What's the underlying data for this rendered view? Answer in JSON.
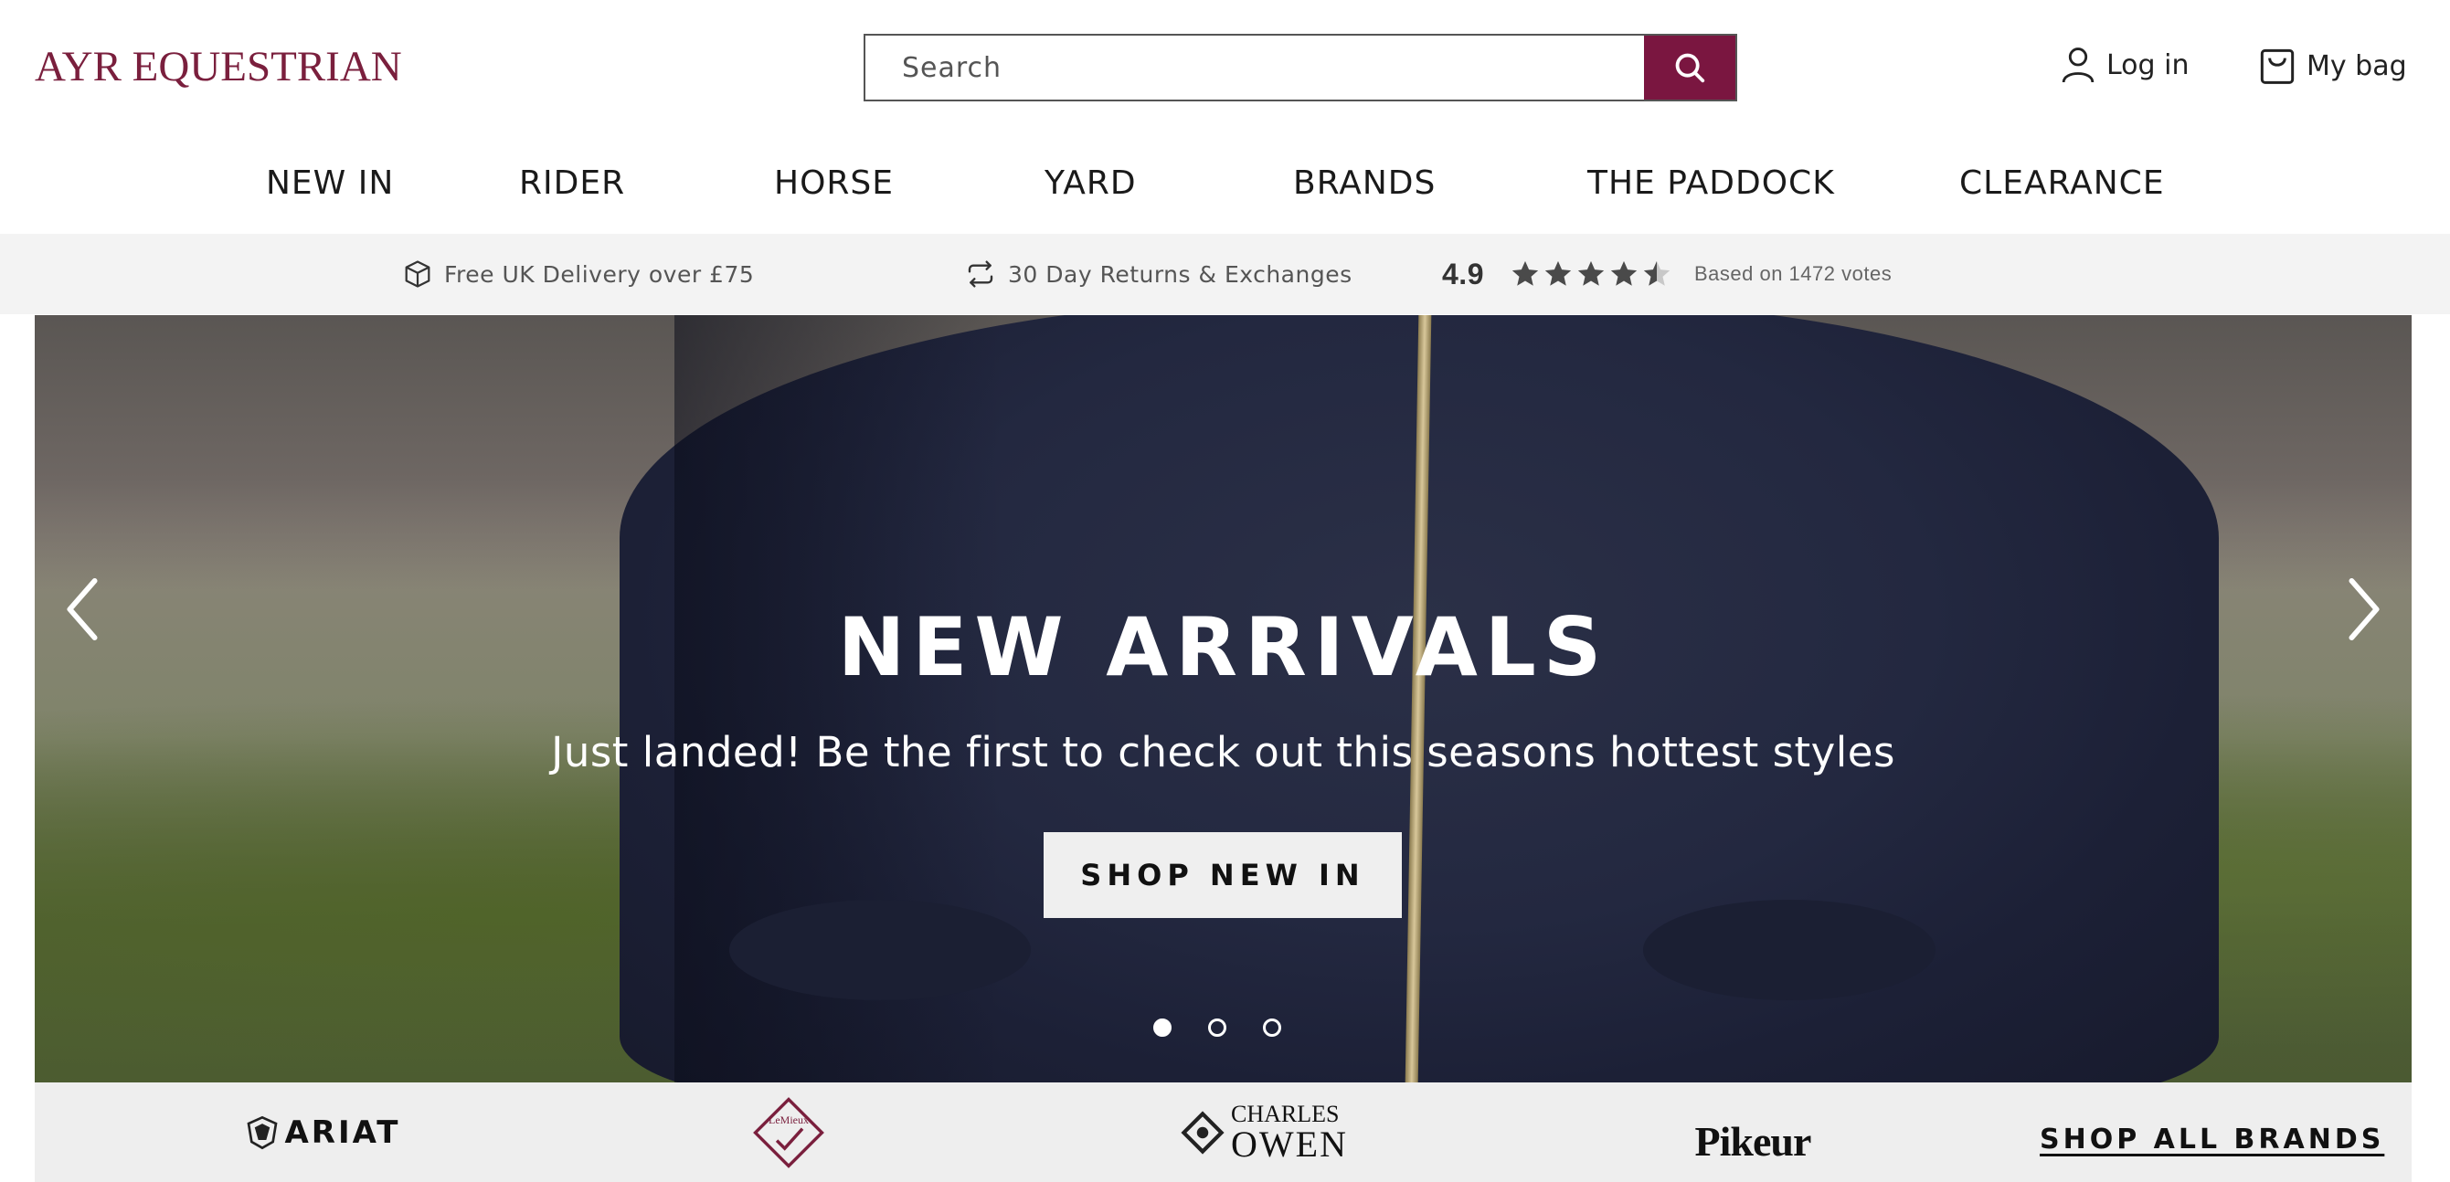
{
  "brand": {
    "logo_text_left": "AYR E",
    "logo_text_right": "QUESTRIAN",
    "accent": "#7a1640"
  },
  "search": {
    "placeholder": "Search"
  },
  "header": {
    "login_label": "Log in",
    "bag_label": "My bag"
  },
  "nav": {
    "items": [
      "NEW IN",
      "RIDER",
      "HORSE",
      "YARD",
      "BRANDS",
      "THE PADDOCK",
      "CLEARANCE"
    ]
  },
  "usp": {
    "delivery": "Free UK Delivery over £75",
    "returns": "30 Day Returns & Exchanges",
    "rating": "4.9",
    "rating_stars": 4.5,
    "votes": "Based on 1472 votes"
  },
  "hero": {
    "title": "NEW ARRIVALS",
    "subtitle": "Just landed! Be the first to check out this seasons hottest styles",
    "cta": "SHOP NEW IN",
    "slides": 3,
    "active_slide": 1
  },
  "brands": {
    "logos": [
      "ARIAT",
      "LeMieux",
      "CHARLES OWEN",
      "Pikeur"
    ],
    "charles_owen_line1": "CHARLES",
    "charles_owen_line2": "OWEN",
    "shop_all": "SHOP ALL BRANDS"
  }
}
